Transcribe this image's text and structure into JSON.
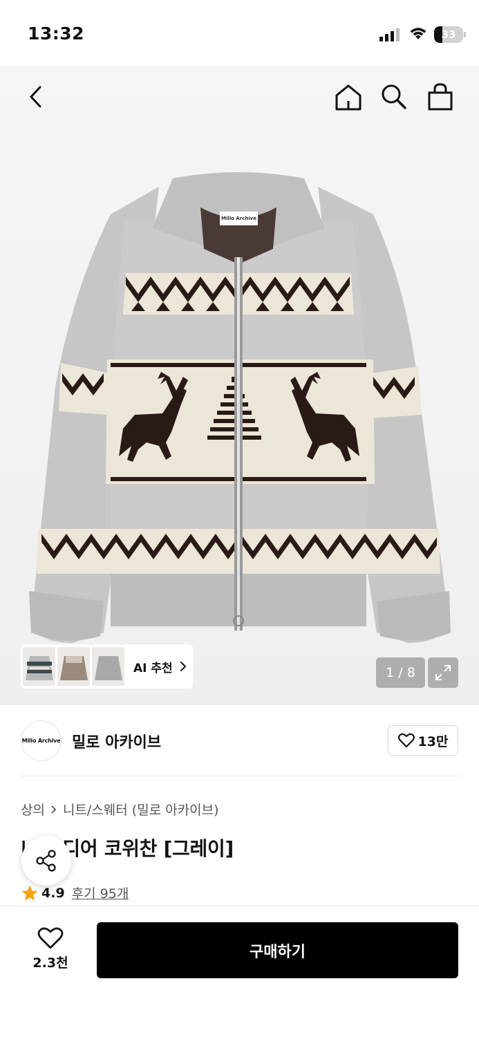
{
  "status_bar": {
    "time": "13:32",
    "battery": "33"
  },
  "product_image": {
    "tag_label": "Millo Archive",
    "counter": "1 / 8"
  },
  "ai_recommend": {
    "label": "AI 추천"
  },
  "brand": {
    "logo_text": "Millo Archive",
    "name": "밀로 아카이브",
    "likes": "13만"
  },
  "breadcrumb": {
    "category": "상의",
    "subcategory": "니트/스웨터 (밀로 아카이브)"
  },
  "product": {
    "title": "니트 디어 코위찬 [그레이]",
    "rating": "4.9",
    "reviews": "후기 95개"
  },
  "bottom_bar": {
    "wish_count": "2.3천",
    "buy_label": "구매하기"
  },
  "colors": {
    "sweater": "#c9c9c9",
    "band": "#ece6d8",
    "pattern": "#2a1a16",
    "star": "#f4a217"
  }
}
